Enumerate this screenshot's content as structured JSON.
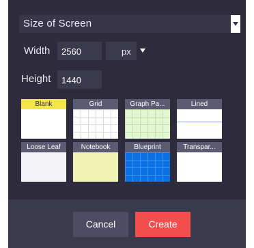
{
  "size_select": {
    "value": "Size of Screen"
  },
  "width": {
    "label": "Width",
    "value": "2560"
  },
  "height": {
    "label": "Height",
    "value": "1440"
  },
  "unit_select": {
    "value": "px"
  },
  "templates": [
    {
      "label": "Blank"
    },
    {
      "label": "Grid"
    },
    {
      "label": "Graph Pa..."
    },
    {
      "label": "Lined"
    },
    {
      "label": "Loose Leaf"
    },
    {
      "label": "Notebook"
    },
    {
      "label": "Blueprint"
    },
    {
      "label": "Transpar..."
    }
  ],
  "buttons": {
    "cancel": "Cancel",
    "create": "Create"
  },
  "colors": {
    "dialog_bg": "#2d2b3c",
    "create_button": "#f24e4e",
    "blank_header": "#f4e44c",
    "blueprint": "#0a70e3"
  },
  "icons": {
    "dropdown": "chevron-down-icon"
  }
}
